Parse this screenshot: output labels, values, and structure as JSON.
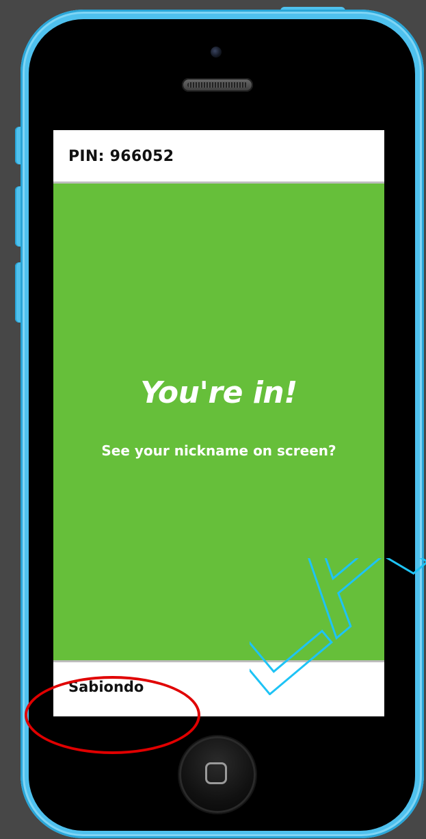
{
  "screen": {
    "pin_text": "PIN: 966052",
    "headline": "You're in!",
    "subtext": "See your nickname on screen?",
    "nickname": "Sabiondo"
  },
  "watermark": {
    "text": "LA",
    "color": "#1ec3f5"
  },
  "colors": {
    "phone_body": "#4fc1ee",
    "screen_bg": "#66bf3a",
    "highlight": "#e00000"
  },
  "icons": {
    "home": "rounded-square-icon",
    "camera": "camera-lens-icon",
    "speaker": "speaker-grille-icon"
  }
}
